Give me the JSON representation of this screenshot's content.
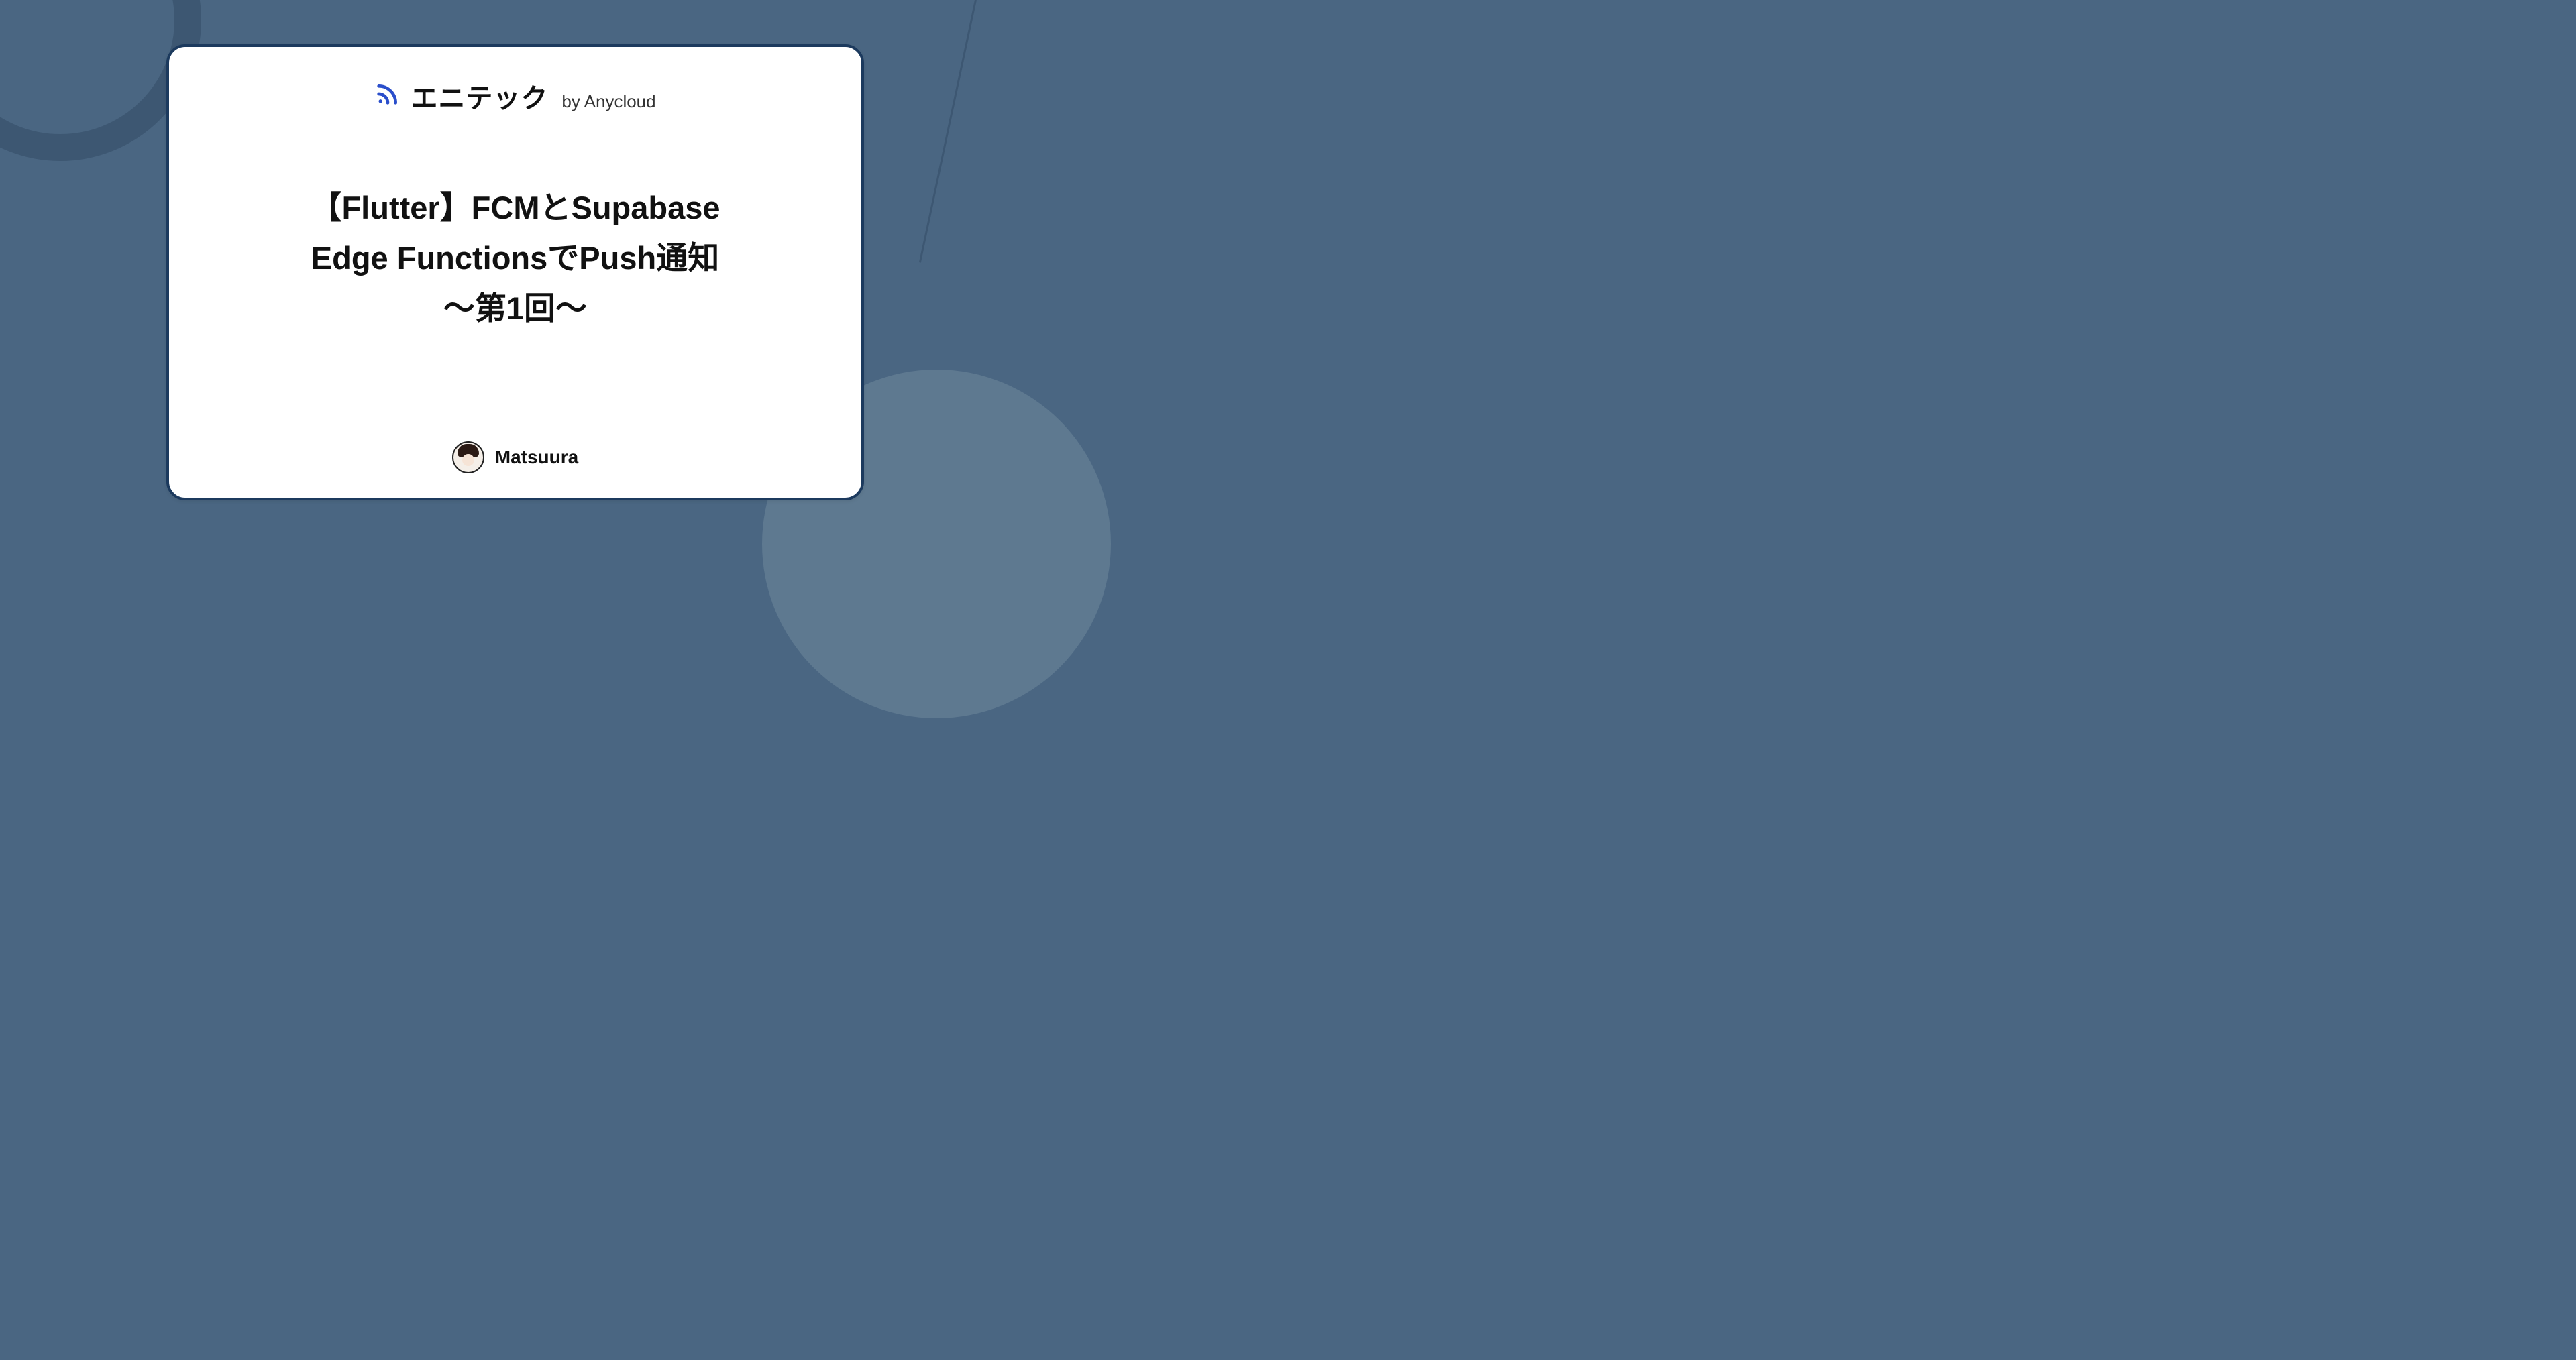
{
  "brand": {
    "title": "エニテック",
    "subtitle": "by Anycloud"
  },
  "article": {
    "title": "【Flutter】FCMとSupabase\nEdge FunctionsでPush通知\n〜第1回〜"
  },
  "author": {
    "name": "Matsuura"
  }
}
